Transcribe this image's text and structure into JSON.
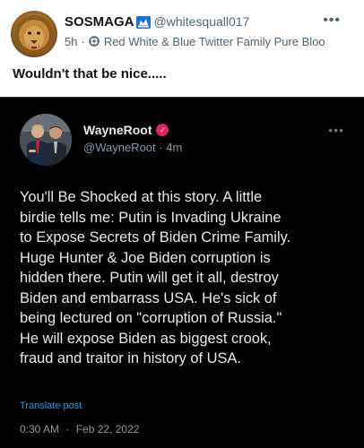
{
  "outer_post": {
    "display_name": "SOSMAGA",
    "badge_icon": "blue-emblem-icon",
    "handle": "@whitesquall017",
    "time": "5h",
    "separator": "·",
    "community_icon": "community-icon",
    "community_name": "Red White & Blue Twitter Family Pure Bloo",
    "more_label": "•••",
    "text": "Wouldn't that be nice....."
  },
  "quoted_screenshot": {
    "display_name": "WayneRoot",
    "verified_mark": "✓",
    "handle": "@WayneRoot",
    "separator": "·",
    "time": "4m",
    "more_label": "•••",
    "body_lines": [
      "You'll Be Shocked at this story. A little",
      "birdie tells me: Putin is Invading Ukraine",
      "to Expose Secrets of Biden Crime Family.",
      "Huge Hunter & Joe Biden corruption is",
      "hidden there. Putin will get it all, destroy",
      "Biden and embarrass USA. He's sick of",
      "being lectured on \"corruption of Russia.\"",
      "He will expose Biden as biggest crook,",
      "fraud and traitor in history of USA."
    ],
    "translate_label": "Translate post",
    "timestamp_time": "0:30 AM",
    "timestamp_date": "Feb 22, 2022"
  },
  "colors": {
    "verified": "#e0245e",
    "link": "#1d9bf0",
    "screenshot_bg": "#000000"
  }
}
